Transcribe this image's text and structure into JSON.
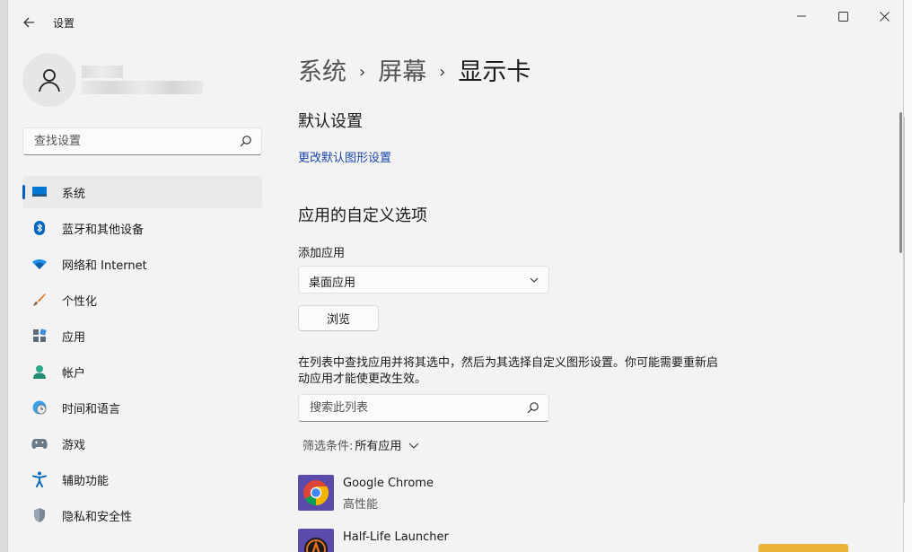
{
  "window": {
    "title": "设置",
    "back_icon": "arrow-left-icon",
    "controls": [
      "minimize-icon",
      "maximize-icon",
      "close-icon"
    ]
  },
  "sidebar": {
    "search_placeholder": "查找设置",
    "items": [
      {
        "label": "系统",
        "icon": "monitor-icon",
        "active": true
      },
      {
        "label": "蓝牙和其他设备",
        "icon": "bluetooth-icon"
      },
      {
        "label": "网络和 Internet",
        "icon": "wifi-icon"
      },
      {
        "label": "个性化",
        "icon": "brush-icon"
      },
      {
        "label": "应用",
        "icon": "apps-icon"
      },
      {
        "label": "帐户",
        "icon": "person-icon"
      },
      {
        "label": "时间和语言",
        "icon": "globe-clock-icon"
      },
      {
        "label": "游戏",
        "icon": "gamepad-icon"
      },
      {
        "label": "辅助功能",
        "icon": "accessibility-icon"
      },
      {
        "label": "隐私和安全性",
        "icon": "shield-icon"
      }
    ]
  },
  "main": {
    "breadcrumb": [
      "系统",
      "屏幕",
      "显示卡"
    ],
    "default_section": {
      "title": "默认设置",
      "link": "更改默认图形设置"
    },
    "custom_section": {
      "title": "应用的自定义选项",
      "add_app_label": "添加应用",
      "app_type_selected": "桌面应用",
      "browse_button": "浏览",
      "description": "在列表中查找应用并将其选中，然后为其选择自定义图形设置。你可能需要重新启动应用才能使更改生效。",
      "search_placeholder": "搜索此列表",
      "filter_label": "筛选条件:",
      "filter_value": "所有应用"
    },
    "apps": [
      {
        "name": "Google Chrome",
        "setting": "高性能",
        "icon": "chrome-icon"
      },
      {
        "name": "Half-Life Launcher",
        "setting": "",
        "icon": "half-life-icon"
      }
    ]
  },
  "colors": {
    "accent": "#005fb8",
    "link": "#1a46a8",
    "app_tile": "#5a4aaa"
  }
}
